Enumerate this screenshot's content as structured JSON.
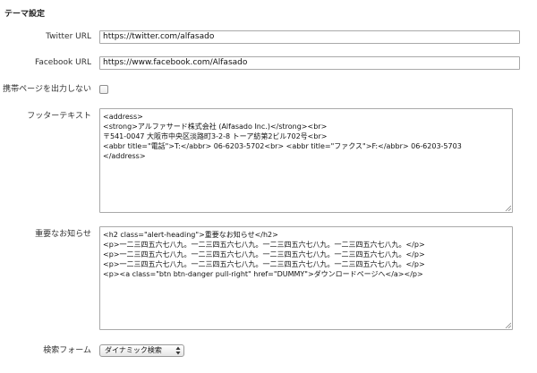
{
  "section": {
    "title": "テーマ設定"
  },
  "fields": {
    "twitter": {
      "label": "Twitter URL",
      "value": "https://twitter.com/alfasado"
    },
    "facebook": {
      "label": "Facebook URL",
      "value": "https://www.facebook.com/Alfasado"
    },
    "mobile": {
      "label": "携帯ページを出力しない",
      "checked": false
    },
    "footer": {
      "label": "フッターテキスト",
      "lines": [
        "<address>",
        "<strong>アルファサード株式会社 (Alfasado Inc.)</strong><br>",
        "〒541-0047 大阪市中央区淡路町3-2-8 トーア紡第2ビル702号<br>",
        "<abbr title=\"電話\">T:</abbr> 06-6203-5702<br> <abbr title=\"ファクス\">F:</abbr> 06-6203-5703",
        "</address>"
      ]
    },
    "notice": {
      "label": "重要なお知らせ",
      "lines": [
        "<h2 class=\"alert-heading\">重要なお知らせ</h2>",
        "<p>一二三四五六七八九。一二三四五六七八九。一二三四五六七八九。一二三四五六七八九。</p>",
        "<p>一二三四五六七八九。一二三四五六七八九。一二三四五六七八九。一二三四五六七八九。</p>",
        "<p>一二三四五六七八九。一二三四五六七八九。一二三四五六七八九。一二三四五六七八九。</p>",
        "<p><a class=\"btn btn-danger pull-right\" href=\"DUMMY\">ダウンロードページへ</a></p>"
      ]
    },
    "search": {
      "label": "検索フォーム",
      "selected": "ダイナミック検索"
    }
  },
  "colors": {
    "border": "#a9a9a9",
    "text": "#222222",
    "background": "#ffffff"
  }
}
